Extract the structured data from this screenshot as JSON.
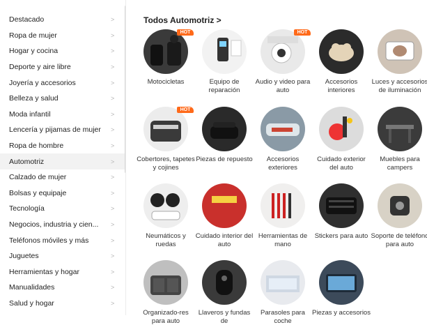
{
  "sidebar": {
    "items": [
      {
        "label": "Destacado"
      },
      {
        "label": "Ropa de mujer"
      },
      {
        "label": "Hogar y cocina"
      },
      {
        "label": "Deporte y aire libre"
      },
      {
        "label": "Joyería y accesorios"
      },
      {
        "label": "Belleza y salud"
      },
      {
        "label": "Moda infantil"
      },
      {
        "label": "Lencería y pijamas de mujer"
      },
      {
        "label": "Ropa de hombre"
      },
      {
        "label": "Automotriz"
      },
      {
        "label": "Calzado de mujer"
      },
      {
        "label": "Bolsas y equipaje"
      },
      {
        "label": "Tecnología"
      },
      {
        "label": "Negocios, industria y cien..."
      },
      {
        "label": "Teléfonos móviles y más"
      },
      {
        "label": "Juguetes"
      },
      {
        "label": "Herramientas y hogar"
      },
      {
        "label": "Manualidades"
      },
      {
        "label": "Salud y hogar"
      }
    ],
    "active_index": 9,
    "chevron": ">"
  },
  "main": {
    "section_title": "Todos Automotriz >",
    "hot_badge": "HOT",
    "categories": [
      {
        "label": "Motocicletas",
        "hot": true,
        "icon": "motorcycle-jacket-icon"
      },
      {
        "label": "Equipo de reparación",
        "hot": false,
        "icon": "battery-tester-icon"
      },
      {
        "label": "Audio y video para auto",
        "hot": true,
        "icon": "dash-camera-icon"
      },
      {
        "label": "Accesorios interiores",
        "hot": false,
        "icon": "car-ornament-icon"
      },
      {
        "label": "Luces y accesorios de iluminación",
        "hot": false,
        "icon": "mirror-light-icon"
      },
      {
        "label": "Cobertores, tapetes y cojines",
        "hot": true,
        "icon": "car-seat-cover-icon"
      },
      {
        "label": "Piezas de repuesto",
        "hot": false,
        "icon": "armrest-icon"
      },
      {
        "label": "Accesorios exteriores",
        "hot": false,
        "icon": "car-exterior-icon"
      },
      {
        "label": "Cuidado exterior del auto",
        "hot": false,
        "icon": "pressure-washer-icon"
      },
      {
        "label": "Muebles para campers",
        "hot": false,
        "icon": "camper-table-icon"
      },
      {
        "label": "Neumáticos y ruedas",
        "hot": false,
        "icon": "wheel-covers-icon"
      },
      {
        "label": "Cuidado interior del auto",
        "hot": false,
        "icon": "interior-cleaner-icon"
      },
      {
        "label": "Herramientas de mano",
        "hot": false,
        "icon": "tool-set-icon"
      },
      {
        "label": "Stickers para auto",
        "hot": false,
        "icon": "window-visor-icon"
      },
      {
        "label": "Soporte de teléfono para auto",
        "hot": false,
        "icon": "phone-holder-icon"
      },
      {
        "label": "Organizado-res para auto",
        "hot": false,
        "icon": "trunk-organizer-icon"
      },
      {
        "label": "Llaveros y fundas de",
        "hot": false,
        "icon": "key-fob-cover-icon"
      },
      {
        "label": "Parasoles para coche",
        "hot": false,
        "icon": "sunshade-icon"
      },
      {
        "label": "Piezas y accesorios",
        "hot": false,
        "icon": "car-monitor-icon"
      }
    ]
  },
  "colors": {
    "hot_badge": "#ff6a1a",
    "active_bg": "#f2f2f2",
    "text": "#222222"
  }
}
